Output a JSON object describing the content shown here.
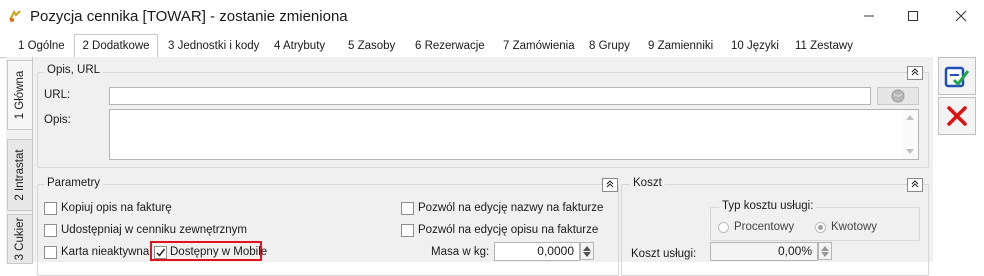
{
  "window": {
    "title": "Pozycja cennika [TOWAR] - zostanie zmieniona",
    "controls": [
      "minimize",
      "maximize",
      "close"
    ]
  },
  "tabs": [
    {
      "label": "1 Ogólne"
    },
    {
      "label": "2 Dodatkowe"
    },
    {
      "label": "3 Jednostki i kody"
    },
    {
      "label": "4 Atrybuty"
    },
    {
      "label": "5 Zasoby"
    },
    {
      "label": "6 Rezerwacje"
    },
    {
      "label": "7 Zamówienia"
    },
    {
      "label": "8 Grupy"
    },
    {
      "label": "9 Zamienniki"
    },
    {
      "label": "10 Języki"
    },
    {
      "label": "11 Zestawy"
    }
  ],
  "vertical_tabs": [
    {
      "label": "1 Główna"
    },
    {
      "label": "2 Intrastat"
    },
    {
      "label": "3 Cukier"
    }
  ],
  "opis_group": {
    "legend": "Opis, URL",
    "url_label": "URL:",
    "url_value": "",
    "opis_label": "Opis:",
    "opis_value": ""
  },
  "parametry_group": {
    "legend": "Parametry",
    "checkboxes": [
      {
        "label": "Kopiuj opis na fakturę",
        "checked": false
      },
      {
        "label": "Udostępniaj w cenniku zewnętrznym",
        "checked": false
      },
      {
        "label": "Karta nieaktywna",
        "checked": false
      },
      {
        "label": "Dostępny w Mobile",
        "checked": true
      },
      {
        "label": "Pozwól na edycję nazwy na fakturze",
        "checked": false
      },
      {
        "label": "Pozwól na edycję opisu na fakturze",
        "checked": false
      }
    ],
    "masa_label": "Masa w kg:",
    "masa_value": "0,0000"
  },
  "koszt_group": {
    "legend": "Koszt",
    "typ_legend": "Typ kosztu usługi:",
    "radio_options": [
      {
        "label": "Procentowy",
        "selected": false
      },
      {
        "label": "Kwotowy",
        "selected": true
      }
    ],
    "koszt_label": "Koszt usługi:",
    "koszt_value": "0,00%"
  },
  "colors": {
    "highlight_border": "#e0141e",
    "save_icon": "#1f4fb5",
    "cancel_icon": "#e01010"
  }
}
